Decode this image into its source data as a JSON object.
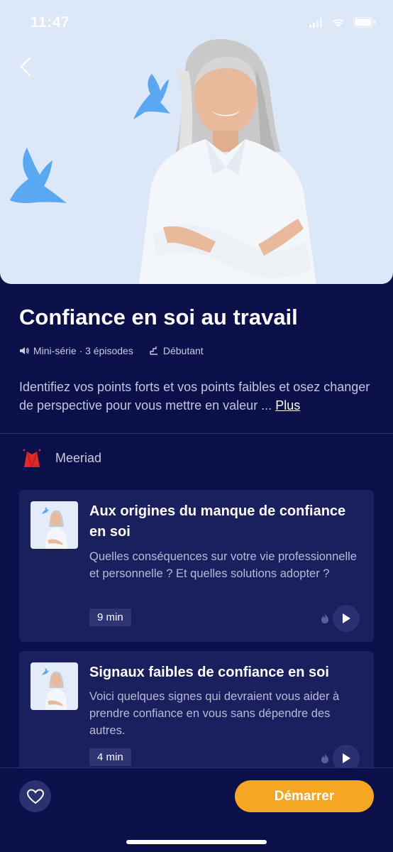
{
  "status_bar": {
    "time": "11:47"
  },
  "header": {
    "title": "Confiance en soi au travail",
    "meta": {
      "format": "Mini-série · 3 épisodes",
      "level": "Débutant"
    },
    "description": "Identifiez vos points forts et vos points faibles et osez changer de perspective pour vous mettre en valeur ...",
    "more_label": "Plus"
  },
  "author": {
    "name": "Meeriad"
  },
  "episodes": [
    {
      "title": "Aux origines du manque de confiance en soi",
      "description": "Quelles conséquences sur votre vie professionnelle et personnelle ? Et quelles solutions adopter ?",
      "duration": "9 min"
    },
    {
      "title": "Signaux faibles de confiance en soi",
      "description": "Voici quelques signes qui devraient vous aider à prendre confiance en vous sans dépendre des autres.",
      "duration": "4 min"
    }
  ],
  "footer": {
    "start_label": "Démarrer"
  },
  "colors": {
    "background": "#0b0f4a",
    "card": "#1a1f5e",
    "accent": "#f5a623",
    "hero": "#dce8f7",
    "bird": "#5aa8f2"
  },
  "icons": [
    "back-arrow-icon",
    "signal-icon",
    "wifi-icon",
    "battery-icon",
    "speaker-icon",
    "level-icon",
    "author-logo-icon",
    "flame-icon",
    "play-icon",
    "heart-icon"
  ]
}
